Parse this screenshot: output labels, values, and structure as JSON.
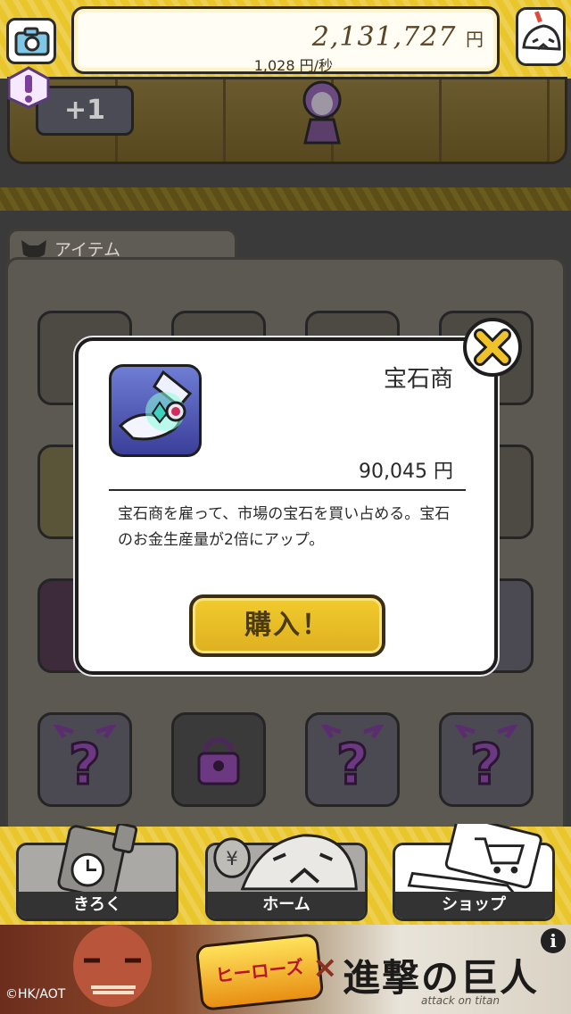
{
  "header": {
    "money_total": "2,131,727",
    "money_unit": "円",
    "money_rate": "1,028 円/秒",
    "camera_icon": "camera-icon",
    "alert_icon": "exclamation-icon"
  },
  "item_panel": {
    "tab_label": "アイテム"
  },
  "nav": {
    "record_label": "きろく",
    "home_label": "ホーム",
    "shop_label": "ショップ"
  },
  "dialog": {
    "item_name": "宝石商",
    "price": "90,045 円",
    "description": "宝石商を雇って、市場の宝石を買い占める。宝石のお金生産量が2倍にアップ。",
    "buy_label": "購入！"
  },
  "ad": {
    "logo_left": "ヒーローズ",
    "cross": "×",
    "logo_right": "進撃の巨人",
    "subtitle": "attack on titan",
    "copyright": "©HK/AOT",
    "info": "i"
  },
  "colors": {
    "accent_yellow": "#e9c62c",
    "button_gold": "#f2cb2d",
    "dialog_bg": "#ffffff"
  }
}
